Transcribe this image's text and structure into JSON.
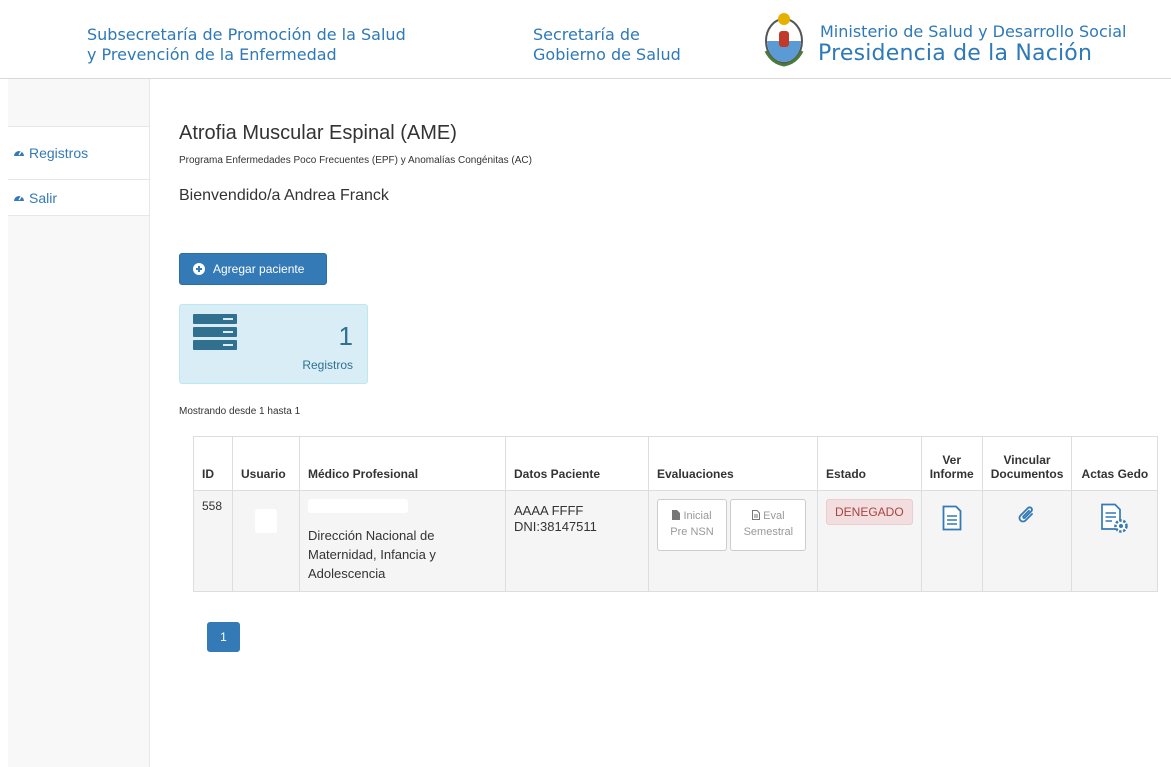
{
  "header": {
    "subsecretaria_line1": "Subsecretaría de Promoción de la Salud",
    "subsecretaria_line2": "y Prevención de la Enfermedad",
    "secretaria_line1": "Secretaría de",
    "secretaria_line2": "Gobierno de Salud",
    "ministerio": "Ministerio de Salud y Desarrollo Social",
    "presidencia": "Presidencia de la Nación",
    "brand_color": "#2e79b8"
  },
  "sidebar": {
    "items": [
      {
        "label": "Registros",
        "icon": "dashboard-icon"
      },
      {
        "label": "Salir",
        "icon": "dashboard-icon"
      }
    ]
  },
  "main": {
    "title": "Atrofia Muscular Espinal (AME)",
    "subtitle": "Programa Enfermedades Poco Frecuentes (EPF) y Anomalías Congénitas (AC)",
    "welcome": "Bienvendido/a Andrea Franck",
    "add_button": "Agregar paciente",
    "panel": {
      "count": "1",
      "label": "Registros",
      "icon": "server-icon"
    },
    "showing": "Mostrando desde 1 hasta 1"
  },
  "table": {
    "headers": {
      "id": "ID",
      "usuario": "Usuario",
      "medico": "Médico Profesional",
      "datos": "Datos Paciente",
      "evaluaciones": "Evaluaciones",
      "estado": "Estado",
      "ver_informe_1": "Ver",
      "ver_informe_2": "Informe",
      "vincular_1": "Vincular",
      "vincular_2": "Documentos",
      "actas": "Actas Gedo"
    },
    "rows": [
      {
        "id": "558",
        "medico": "Dirección Nacional de Maternidad, Infancia y Adolescencia",
        "paciente_nombre": "AAAA FFFF",
        "paciente_dni": "DNI:38147511",
        "eval1_line1": "Inicial",
        "eval1_line2": "Pre NSN",
        "eval2_line1": "Eval",
        "eval2_line2": "Semestral",
        "estado": "DENEGADO",
        "estado_color": "#a94442"
      }
    ]
  },
  "pagination": {
    "current": "1"
  }
}
